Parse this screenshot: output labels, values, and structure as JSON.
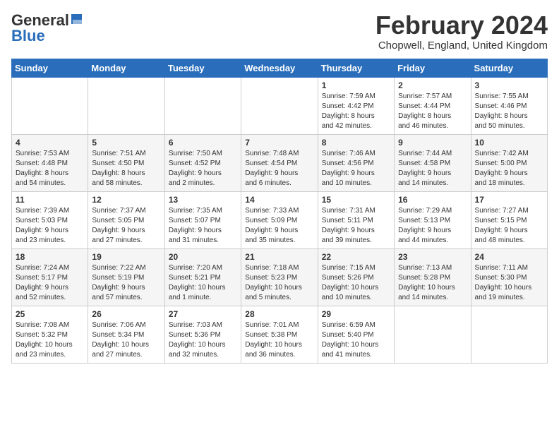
{
  "header": {
    "logo_general": "General",
    "logo_blue": "Blue",
    "month_title": "February 2024",
    "location": "Chopwell, England, United Kingdom"
  },
  "days_of_week": [
    "Sunday",
    "Monday",
    "Tuesday",
    "Wednesday",
    "Thursday",
    "Friday",
    "Saturday"
  ],
  "weeks": [
    [
      {
        "day": "",
        "info": ""
      },
      {
        "day": "",
        "info": ""
      },
      {
        "day": "",
        "info": ""
      },
      {
        "day": "",
        "info": ""
      },
      {
        "day": "1",
        "info": "Sunrise: 7:59 AM\nSunset: 4:42 PM\nDaylight: 8 hours\nand 42 minutes."
      },
      {
        "day": "2",
        "info": "Sunrise: 7:57 AM\nSunset: 4:44 PM\nDaylight: 8 hours\nand 46 minutes."
      },
      {
        "day": "3",
        "info": "Sunrise: 7:55 AM\nSunset: 4:46 PM\nDaylight: 8 hours\nand 50 minutes."
      }
    ],
    [
      {
        "day": "4",
        "info": "Sunrise: 7:53 AM\nSunset: 4:48 PM\nDaylight: 8 hours\nand 54 minutes."
      },
      {
        "day": "5",
        "info": "Sunrise: 7:51 AM\nSunset: 4:50 PM\nDaylight: 8 hours\nand 58 minutes."
      },
      {
        "day": "6",
        "info": "Sunrise: 7:50 AM\nSunset: 4:52 PM\nDaylight: 9 hours\nand 2 minutes."
      },
      {
        "day": "7",
        "info": "Sunrise: 7:48 AM\nSunset: 4:54 PM\nDaylight: 9 hours\nand 6 minutes."
      },
      {
        "day": "8",
        "info": "Sunrise: 7:46 AM\nSunset: 4:56 PM\nDaylight: 9 hours\nand 10 minutes."
      },
      {
        "day": "9",
        "info": "Sunrise: 7:44 AM\nSunset: 4:58 PM\nDaylight: 9 hours\nand 14 minutes."
      },
      {
        "day": "10",
        "info": "Sunrise: 7:42 AM\nSunset: 5:00 PM\nDaylight: 9 hours\nand 18 minutes."
      }
    ],
    [
      {
        "day": "11",
        "info": "Sunrise: 7:39 AM\nSunset: 5:03 PM\nDaylight: 9 hours\nand 23 minutes."
      },
      {
        "day": "12",
        "info": "Sunrise: 7:37 AM\nSunset: 5:05 PM\nDaylight: 9 hours\nand 27 minutes."
      },
      {
        "day": "13",
        "info": "Sunrise: 7:35 AM\nSunset: 5:07 PM\nDaylight: 9 hours\nand 31 minutes."
      },
      {
        "day": "14",
        "info": "Sunrise: 7:33 AM\nSunset: 5:09 PM\nDaylight: 9 hours\nand 35 minutes."
      },
      {
        "day": "15",
        "info": "Sunrise: 7:31 AM\nSunset: 5:11 PM\nDaylight: 9 hours\nand 39 minutes."
      },
      {
        "day": "16",
        "info": "Sunrise: 7:29 AM\nSunset: 5:13 PM\nDaylight: 9 hours\nand 44 minutes."
      },
      {
        "day": "17",
        "info": "Sunrise: 7:27 AM\nSunset: 5:15 PM\nDaylight: 9 hours\nand 48 minutes."
      }
    ],
    [
      {
        "day": "18",
        "info": "Sunrise: 7:24 AM\nSunset: 5:17 PM\nDaylight: 9 hours\nand 52 minutes."
      },
      {
        "day": "19",
        "info": "Sunrise: 7:22 AM\nSunset: 5:19 PM\nDaylight: 9 hours\nand 57 minutes."
      },
      {
        "day": "20",
        "info": "Sunrise: 7:20 AM\nSunset: 5:21 PM\nDaylight: 10 hours\nand 1 minute."
      },
      {
        "day": "21",
        "info": "Sunrise: 7:18 AM\nSunset: 5:23 PM\nDaylight: 10 hours\nand 5 minutes."
      },
      {
        "day": "22",
        "info": "Sunrise: 7:15 AM\nSunset: 5:26 PM\nDaylight: 10 hours\nand 10 minutes."
      },
      {
        "day": "23",
        "info": "Sunrise: 7:13 AM\nSunset: 5:28 PM\nDaylight: 10 hours\nand 14 minutes."
      },
      {
        "day": "24",
        "info": "Sunrise: 7:11 AM\nSunset: 5:30 PM\nDaylight: 10 hours\nand 19 minutes."
      }
    ],
    [
      {
        "day": "25",
        "info": "Sunrise: 7:08 AM\nSunset: 5:32 PM\nDaylight: 10 hours\nand 23 minutes."
      },
      {
        "day": "26",
        "info": "Sunrise: 7:06 AM\nSunset: 5:34 PM\nDaylight: 10 hours\nand 27 minutes."
      },
      {
        "day": "27",
        "info": "Sunrise: 7:03 AM\nSunset: 5:36 PM\nDaylight: 10 hours\nand 32 minutes."
      },
      {
        "day": "28",
        "info": "Sunrise: 7:01 AM\nSunset: 5:38 PM\nDaylight: 10 hours\nand 36 minutes."
      },
      {
        "day": "29",
        "info": "Sunrise: 6:59 AM\nSunset: 5:40 PM\nDaylight: 10 hours\nand 41 minutes."
      },
      {
        "day": "",
        "info": ""
      },
      {
        "day": "",
        "info": ""
      }
    ]
  ]
}
